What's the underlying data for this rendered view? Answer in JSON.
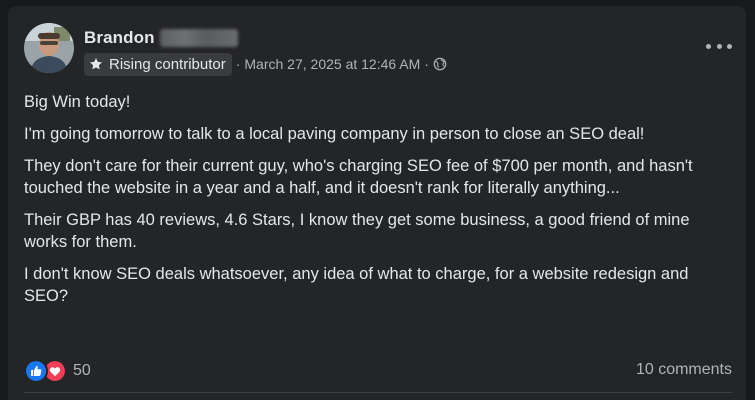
{
  "post": {
    "author": {
      "name": "Brandon",
      "badge": "Rising contributor",
      "badge_icon": "star-icon",
      "avatar_icon": "profile-photo"
    },
    "meta": {
      "separator": "·",
      "timestamp": "March 27, 2025 at 12:46 AM",
      "audience_icon": "globe-icon"
    },
    "menu_icon": "more-options-icon",
    "body": [
      "Big Win today!",
      "I'm going tomorrow to talk to a local paving company in person to close an SEO deal!",
      "They don't care for their current guy, who's charging SEO fee of $700 per month, and hasn't touched the website in a year and a half, and it doesn't rank for literally anything...",
      "Their GBP has 40 reviews, 4.6 Stars, I know they get some business, a good friend of mine works for them.",
      "I don't know SEO deals whatsoever, any idea of what to charge, for a website redesign and SEO?"
    ],
    "reactions": {
      "types": [
        "like-icon",
        "love-icon"
      ],
      "count": "50"
    },
    "comments": "10 comments"
  },
  "colors": {
    "background": "#18191a",
    "card": "#242526",
    "text_primary": "#e4e6eb",
    "text_secondary": "#b0b3b8",
    "badge_bg": "#3a3b3c",
    "like_blue": "#1877f2",
    "love_red": "#f33e58"
  }
}
